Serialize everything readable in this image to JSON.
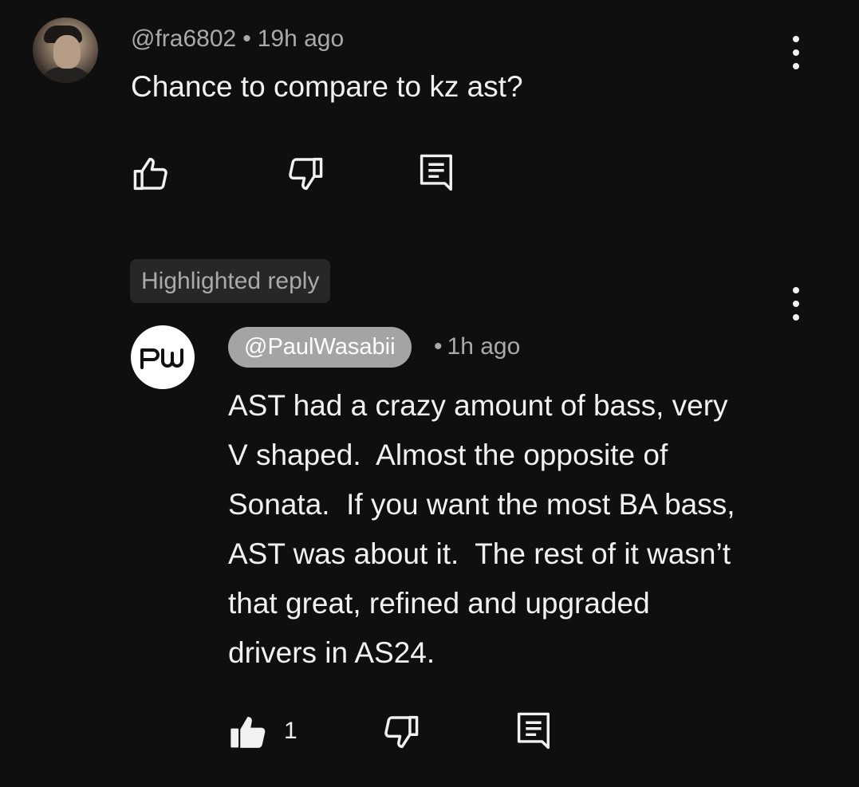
{
  "comment": {
    "author": "@fra6802",
    "time": "19h ago",
    "text": "Chance to compare to kz ast?"
  },
  "badge": {
    "label": "Highlighted reply"
  },
  "reply": {
    "author": "@PaulWasabii",
    "time": "1h ago",
    "text": "AST had a crazy amount of bass, very\nV shaped.  Almost the opposite of\nSonata.  If you want the most BA bass,\nAST was about it.  The rest of it wasn’t\nthat great, refined and upgraded\ndrivers in AS24.",
    "like_count": "1",
    "avatar_initials": "PW"
  },
  "icons": {
    "like": "thumbs-up-outline-icon",
    "dislike": "thumbs-down-outline-icon",
    "reply": "comment-icon",
    "more": "more-vertical-icon",
    "liked": "thumbs-up-filled-icon"
  },
  "colors": {
    "background": "#0f0f0f",
    "text": "#f1f1f1",
    "secondary_text": "#aaaaaa",
    "badge_bg": "#272727",
    "author_chip_bg": "#a4a4a4"
  }
}
